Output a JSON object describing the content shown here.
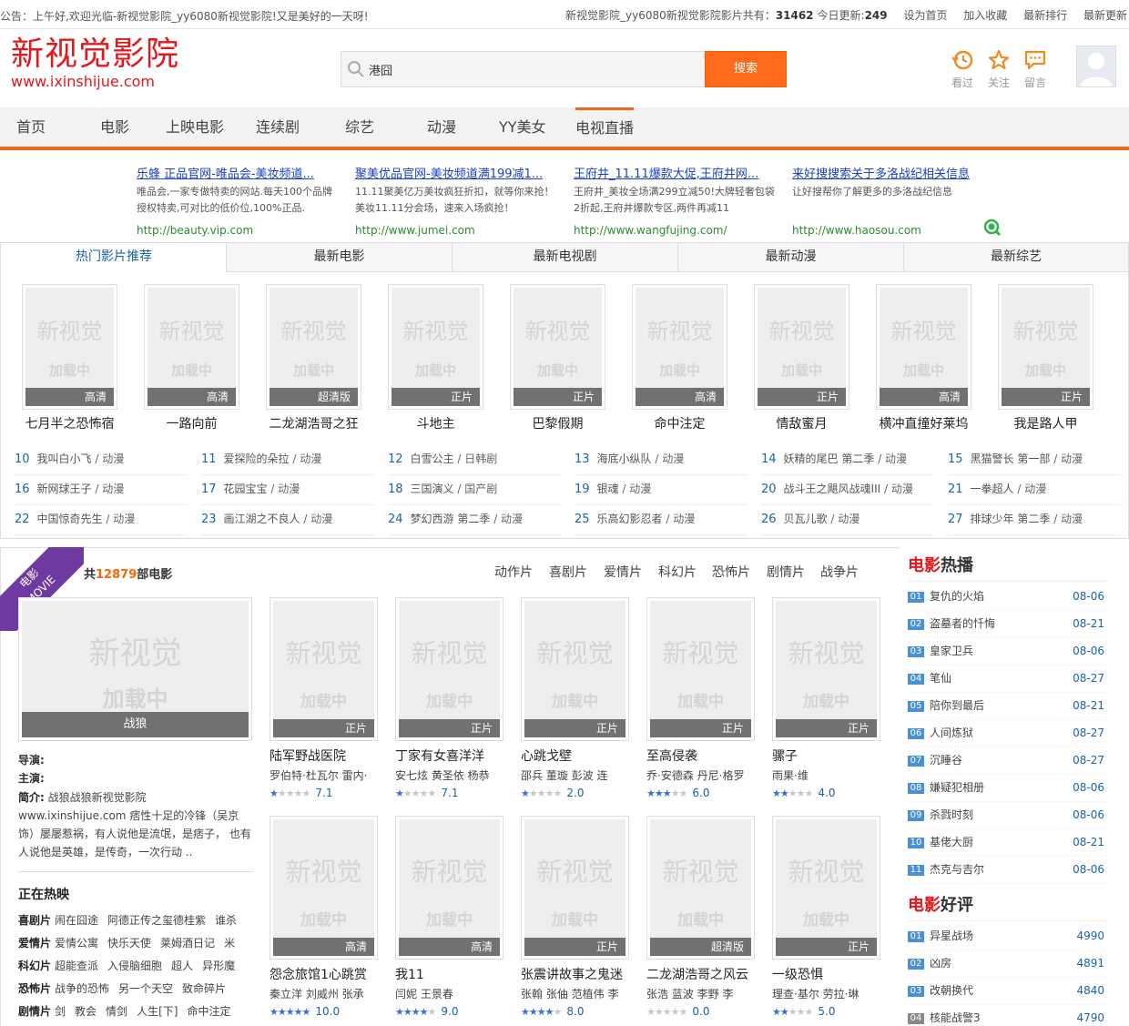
{
  "topbar": {
    "notice": "公告：上午好,欢迎光临-新视觉影院_yy6080新视觉影院!又是美好的一天呀!",
    "site_count_prefix": "新视觉影院_yy6080新视觉影院影片共有：",
    "site_count": "31462",
    "today_prefix": "今日更新:",
    "today_count": "249",
    "links": [
      "设为首页",
      "加入收藏",
      "最新排行",
      "最新更新"
    ]
  },
  "logo": {
    "cn": "新视觉影院",
    "en": "www.ixinshijue.com"
  },
  "search": {
    "value": "港囧",
    "button": "搜索"
  },
  "header_icons": [
    {
      "label": "看过",
      "icon": "history-icon"
    },
    {
      "label": "关注",
      "icon": "star-icon"
    },
    {
      "label": "留言",
      "icon": "message-icon"
    }
  ],
  "nav": [
    "首页",
    "电影",
    "上映电影",
    "连续剧",
    "综艺",
    "动漫",
    "YY美女",
    "电视直播"
  ],
  "ads": [
    {
      "title": "乐蜂 正品官网-唯品会-美妆频道...",
      "desc": "唯品会,一家专做特卖的网站.每天100个品牌授权特卖,可对比的低价位,100%正品.",
      "url": "http://beauty.vip.com"
    },
    {
      "title": "聚美优品官网-美妆频道满199减1...",
      "desc": "11.11聚美亿万美妆疯狂折扣，就等你来抢！美妆11.11分会场，速来入场疯抢！",
      "url": "http://www.jumei.com"
    },
    {
      "title": "王府井_11.11爆款大促,王府井网...",
      "desc": "王府井_美妆全场满299立减50!大牌轻奢包袋2折起,王府井爆款专区,两件再减11",
      "url": "http://www.wangfujing.com/"
    },
    {
      "title": "来好搜搜索关于多洛战纪相关信息",
      "desc": "让好搜帮你了解更多的多洛战纪信息",
      "url": "http://www.haosou.com"
    }
  ],
  "hot_tabs": [
    "热门影片推荐",
    "最新电影",
    "最新电视剧",
    "最新动漫",
    "最新综艺"
  ],
  "watermark": {
    "line1": "新视觉",
    "line2": "加载中"
  },
  "hot_posters": [
    {
      "title": "七月半之恐怖宿",
      "tag": "高清"
    },
    {
      "title": "一路向前",
      "tag": "高清"
    },
    {
      "title": "二龙湖浩哥之狂",
      "tag": "超清版"
    },
    {
      "title": "斗地主",
      "tag": "正片"
    },
    {
      "title": "巴黎假期",
      "tag": "正片"
    },
    {
      "title": "命中注定",
      "tag": "高清"
    },
    {
      "title": "情敌蜜月",
      "tag": "正片"
    },
    {
      "title": "横冲直撞好莱坞",
      "tag": "高清"
    },
    {
      "title": "我是路人甲",
      "tag": "正片"
    }
  ],
  "hot_ranks": [
    {
      "n": "10",
      "name": "我叫白小飞",
      "genre": "动漫"
    },
    {
      "n": "11",
      "name": "爱探险的朵拉",
      "genre": "动漫"
    },
    {
      "n": "12",
      "name": "白雪公主",
      "genre": "日韩剧"
    },
    {
      "n": "13",
      "name": "海底小纵队",
      "genre": "动漫"
    },
    {
      "n": "14",
      "name": "妖精的尾巴 第二季",
      "genre": "动漫"
    },
    {
      "n": "15",
      "name": "黑猫警长 第一部",
      "genre": "动漫"
    },
    {
      "n": "16",
      "name": "新网球王子",
      "genre": "动漫"
    },
    {
      "n": "17",
      "name": "花园宝宝",
      "genre": "动漫"
    },
    {
      "n": "18",
      "name": "三国演义",
      "genre": "国产剧"
    },
    {
      "n": "19",
      "name": "银魂",
      "genre": "动漫"
    },
    {
      "n": "20",
      "name": "战斗王之飓风战魂III",
      "genre": "动漫"
    },
    {
      "n": "21",
      "name": "一拳超人",
      "genre": "动漫"
    },
    {
      "n": "22",
      "name": "中国惊奇先生",
      "genre": "动漫"
    },
    {
      "n": "23",
      "name": "画江湖之不良人",
      "genre": "动漫"
    },
    {
      "n": "24",
      "name": "梦幻西游 第二季",
      "genre": "动漫"
    },
    {
      "n": "25",
      "name": "乐高幻影忍者",
      "genre": "动漫"
    },
    {
      "n": "26",
      "name": "贝瓦儿歌",
      "genre": "动漫"
    },
    {
      "n": "27",
      "name": "排球少年 第二季",
      "genre": "动漫"
    }
  ],
  "movie_section": {
    "ribbon_cn": "电影",
    "ribbon_en": "MOVIE",
    "count_prefix": "共",
    "count": "12879",
    "count_suffix": "部电影",
    "categories": [
      "动作片",
      "喜剧片",
      "爱情片",
      "科幻片",
      "恐怖片",
      "剧情片",
      "战争片"
    ],
    "featured": {
      "title": "战狼",
      "director_label": "导演:",
      "actors_label": "主演:",
      "intro_label": "简介:",
      "intro": "战狼战狼新视觉影院 www.ixinshijue.com 痞性十足的冷锋（吴京 饰）屡屡惹祸，有人说他是流氓，是痞子， 也有人说他是英雄，是传奇，一次行动 .."
    },
    "now_playing_title": "正在热映",
    "now_playing": [
      {
        "label": "喜剧片",
        "items": [
          "闹在囧途",
          "阿德正传之玺德桂紫",
          "谁杀"
        ]
      },
      {
        "label": "爱情片",
        "items": [
          "爱情公寓",
          "快乐天使",
          "莱姆酒日记",
          "米"
        ]
      },
      {
        "label": "科幻片",
        "items": [
          "超能查派",
          "入侵脑细胞",
          "超人",
          "异形魔"
        ]
      },
      {
        "label": "恐怖片",
        "items": [
          "战争的恐怖",
          "另一个天空",
          "致命碎片"
        ]
      },
      {
        "label": "剧情片",
        "items": [
          "剑",
          "教会",
          "情剑",
          "人生[下]",
          "命中注定"
        ]
      }
    ],
    "movies": [
      {
        "title": "陆军野战医院",
        "tag": "正片",
        "cast": "罗伯特·杜瓦尔 雷内·",
        "stars": 1,
        "score": "7.1"
      },
      {
        "title": "丁家有女喜洋洋",
        "tag": "正片",
        "cast": "安七炫 黄圣依 杨恭",
        "stars": 1,
        "score": "7.1"
      },
      {
        "title": "心跳戈壁",
        "tag": "正片",
        "cast": "邵兵 董璇 彭波 连",
        "stars": 1,
        "score": "2.0"
      },
      {
        "title": "至高侵袭",
        "tag": "正片",
        "cast": "乔·安德森 丹尼·格罗",
        "stars": 3,
        "score": "6.0"
      },
      {
        "title": "骡子",
        "tag": "正片",
        "cast": "雨果·维",
        "stars": 2,
        "score": "4.0"
      },
      {
        "title": "怨念旅馆1心跳赏",
        "tag": "高清",
        "cast": "秦立洋 刘威州 张承",
        "stars": 5,
        "score": "10.0"
      },
      {
        "title": "我11",
        "tag": "高清",
        "cast": "闫妮 王景春",
        "stars": 4,
        "score": "9.0"
      },
      {
        "title": "张震讲故事之鬼迷",
        "tag": "正片",
        "cast": "张翰 张伷 范植伟 李",
        "stars": 4,
        "score": "8.0"
      },
      {
        "title": "二龙湖浩哥之风云",
        "tag": "超清版",
        "cast": "张浩 蓝波 李野 李",
        "stars": 0,
        "score": "0.0"
      },
      {
        "title": "一级恐惧",
        "tag": "正片",
        "cast": "理查·基尔 劳拉·琳",
        "stars": 2,
        "score": "5.0"
      }
    ]
  },
  "sidebar": {
    "hot_title_red": "电影",
    "hot_title_rest": "热播",
    "hot": [
      {
        "no": "01",
        "name": "复仇的火焰",
        "date": "08-06"
      },
      {
        "no": "02",
        "name": "盗墓者的忏悔",
        "date": "08-21"
      },
      {
        "no": "03",
        "name": "皇家卫兵",
        "date": "08-06"
      },
      {
        "no": "04",
        "name": "笔仙",
        "date": "08-27"
      },
      {
        "no": "05",
        "name": "陪你到最后",
        "date": "08-21"
      },
      {
        "no": "06",
        "name": "人间炼狱",
        "date": "08-27"
      },
      {
        "no": "07",
        "name": "沉睡谷",
        "date": "08-27"
      },
      {
        "no": "08",
        "name": "嫌疑犯相册",
        "date": "08-06"
      },
      {
        "no": "09",
        "name": "杀戮时刻",
        "date": "08-06"
      },
      {
        "no": "10",
        "name": "基佬大厨",
        "date": "08-21"
      },
      {
        "no": "11",
        "name": "杰克与吉尔",
        "date": "08-06"
      }
    ],
    "good_title_red": "电影",
    "good_title_rest": "好评",
    "good": [
      {
        "no": "01",
        "name": "异星战场",
        "score": "4990"
      },
      {
        "no": "02",
        "name": "凶房",
        "score": "4891"
      },
      {
        "no": "03",
        "name": "改朝换代",
        "score": "4840"
      },
      {
        "no": "04",
        "name": "核能战警3",
        "score": "4790"
      }
    ]
  }
}
